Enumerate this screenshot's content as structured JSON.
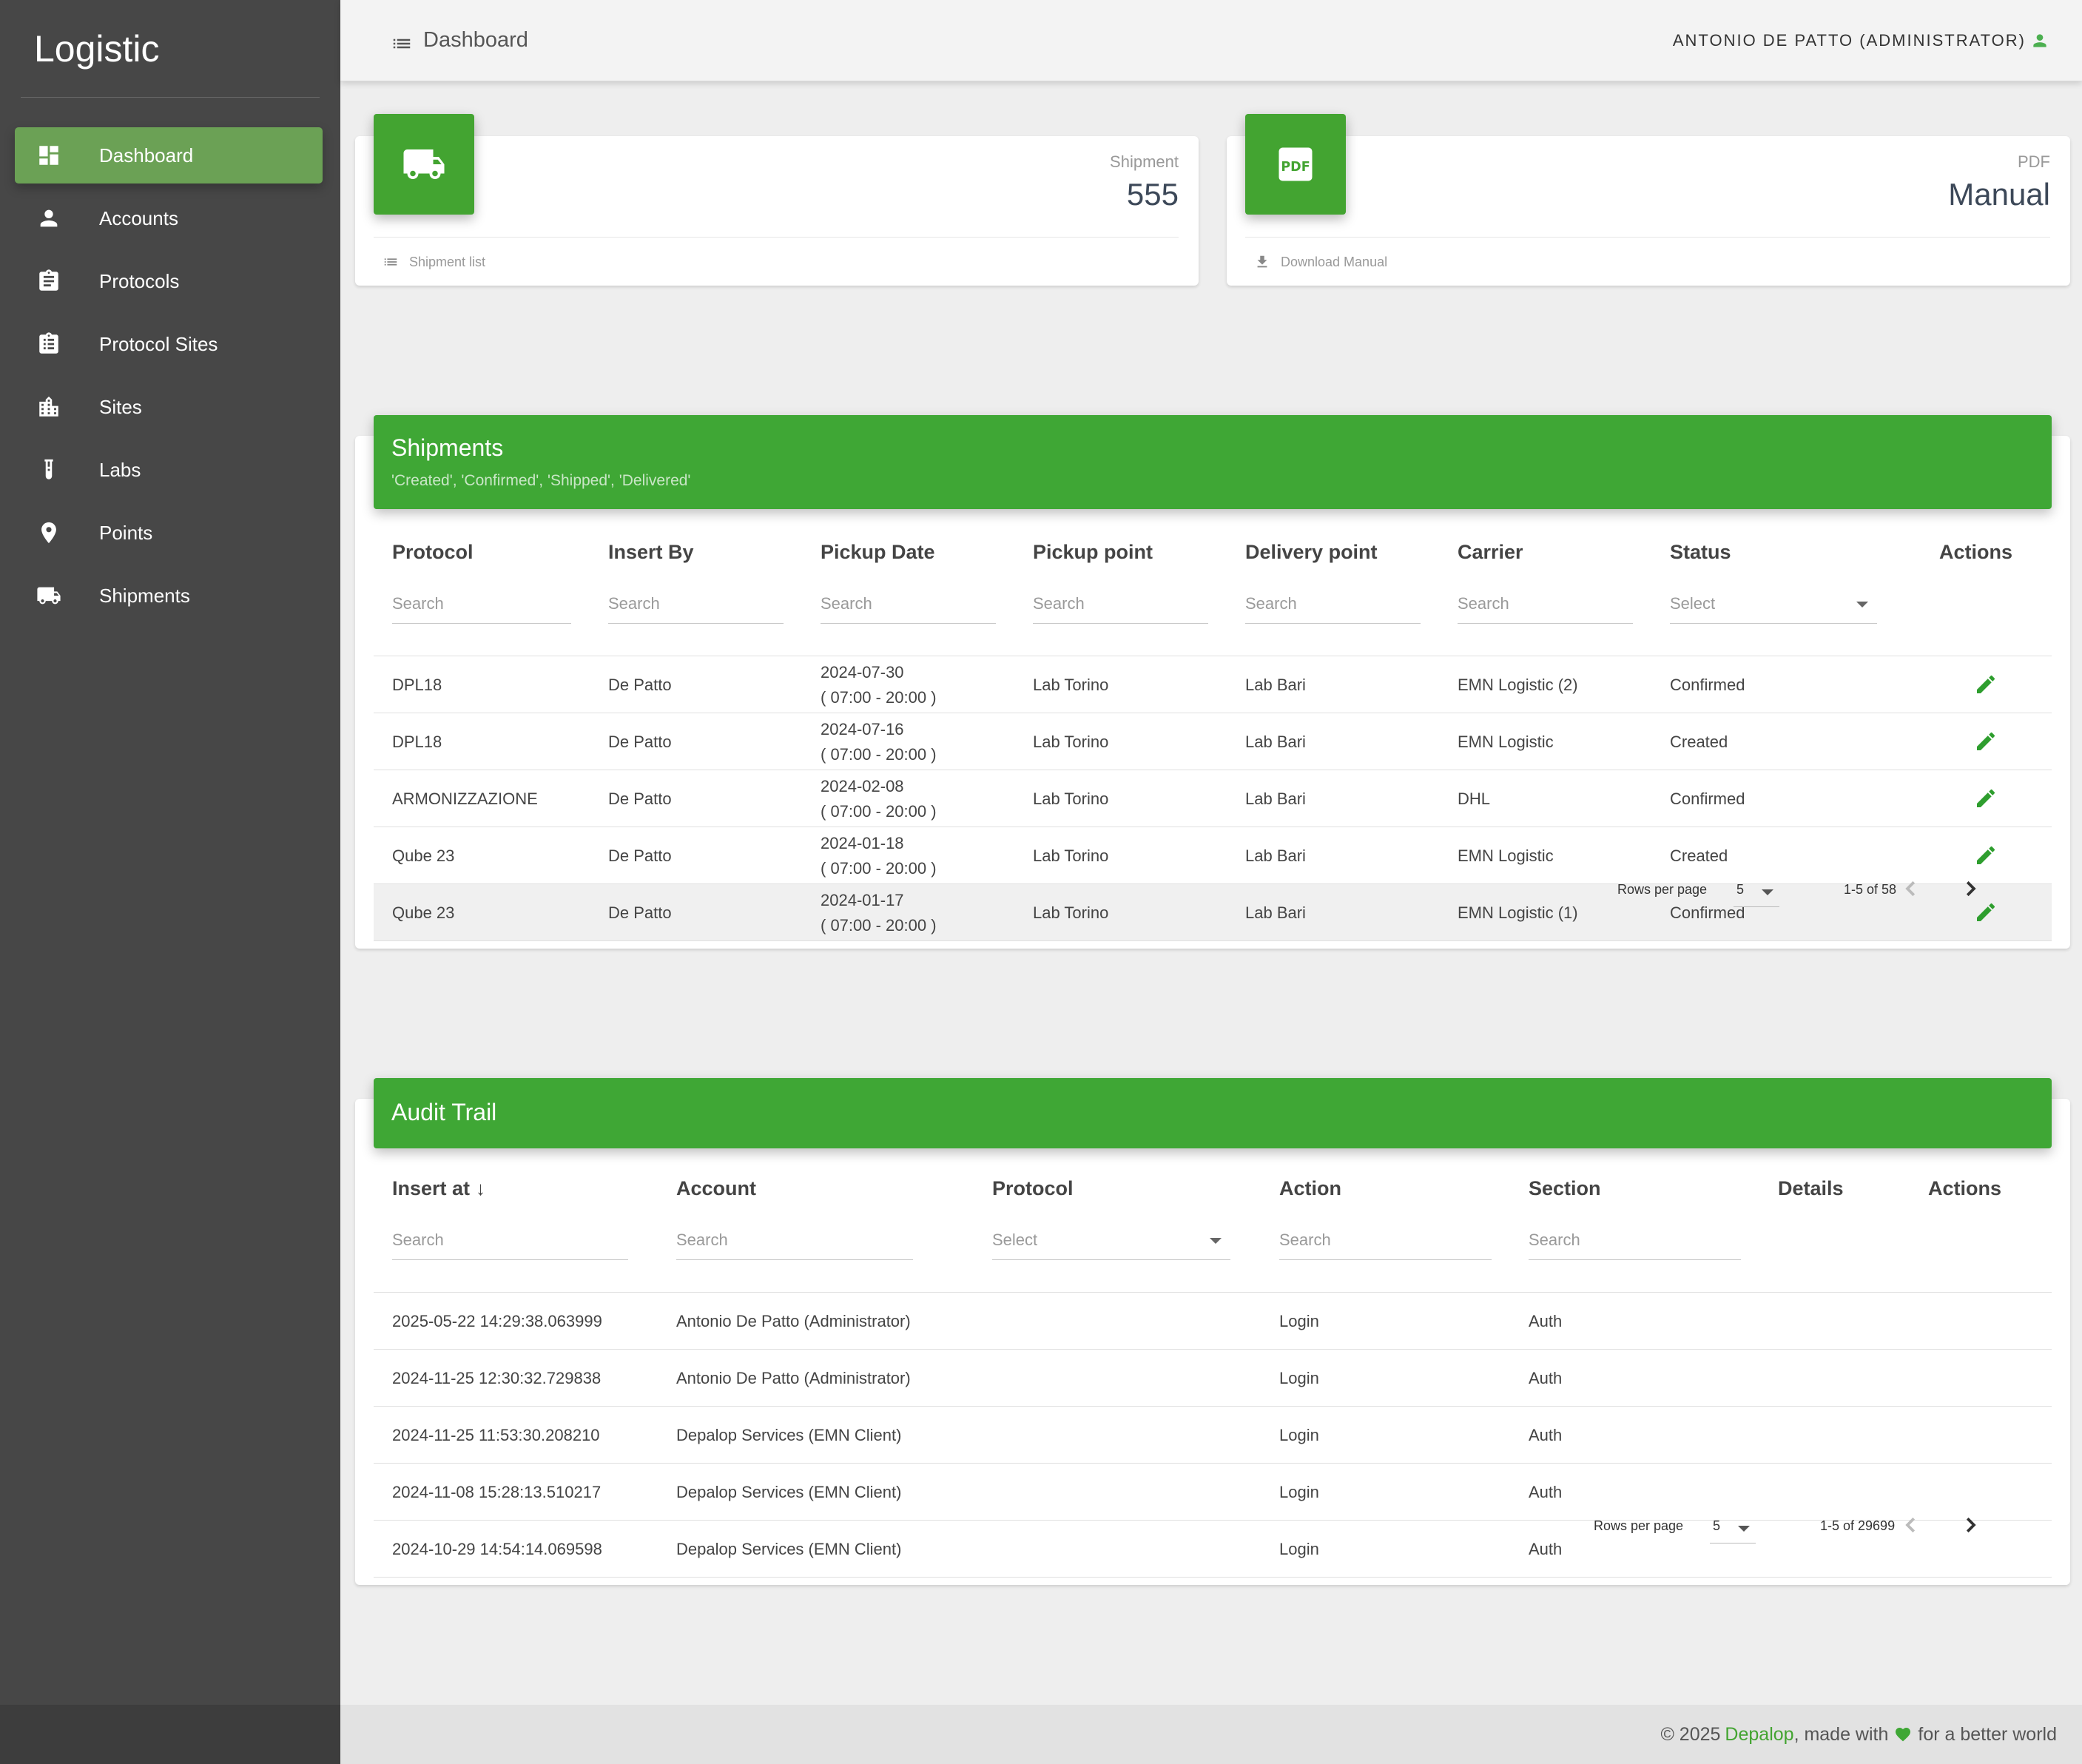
{
  "app": {
    "brand": "Logistic"
  },
  "sidebar": {
    "items": [
      {
        "label": "Dashboard",
        "icon": "dashboard-icon",
        "active": true
      },
      {
        "label": "Accounts",
        "icon": "person-icon"
      },
      {
        "label": "Protocols",
        "icon": "clipboard-icon"
      },
      {
        "label": "Protocol Sites",
        "icon": "clipboard-list-icon"
      },
      {
        "label": "Sites",
        "icon": "building-icon"
      },
      {
        "label": "Labs",
        "icon": "test-tube-icon"
      },
      {
        "label": "Points",
        "icon": "map-pin-icon"
      },
      {
        "label": "Shipments",
        "icon": "truck-icon"
      }
    ]
  },
  "topbar": {
    "title": "Dashboard",
    "user": "ANTONIO DE PATTO (ADMINISTRATOR)"
  },
  "stats": {
    "shipment": {
      "label": "Shipment",
      "value": "555",
      "footer": "Shipment list"
    },
    "manual": {
      "label": "PDF",
      "value": "Manual",
      "footer": "Download Manual"
    }
  },
  "shipments": {
    "title": "Shipments",
    "subtitle": "'Created', 'Confirmed', 'Shipped', 'Delivered'",
    "columns": [
      "Protocol",
      "Insert By",
      "Pickup Date",
      "Pickup point",
      "Delivery point",
      "Carrier",
      "Status",
      "Actions"
    ],
    "filters": {
      "protocol": "Search",
      "insert_by": "Search",
      "pickup_date": "Search",
      "pickup_point": "Search",
      "delivery_point": "Search",
      "carrier": "Search",
      "status": "Select"
    },
    "rows": [
      {
        "protocol": "DPL18",
        "insert_by": "De Patto",
        "date": "2024-07-30",
        "time": "( 07:00 - 20:00 )",
        "pickup": "Lab Torino",
        "delivery": "Lab Bari",
        "carrier": "EMN Logistic (2)",
        "status": "Confirmed"
      },
      {
        "protocol": "DPL18",
        "insert_by": "De Patto",
        "date": "2024-07-16",
        "time": "( 07:00 - 20:00 )",
        "pickup": "Lab Torino",
        "delivery": "Lab Bari",
        "carrier": "EMN Logistic",
        "status": "Created"
      },
      {
        "protocol": "ARMONIZZAZIONE",
        "insert_by": "De Patto",
        "date": "2024-02-08",
        "time": "( 07:00 - 20:00 )",
        "pickup": "Lab Torino",
        "delivery": "Lab Bari",
        "carrier": "DHL",
        "status": "Confirmed"
      },
      {
        "protocol": "Qube 23",
        "insert_by": "De Patto",
        "date": "2024-01-18",
        "time": "( 07:00 - 20:00 )",
        "pickup": "Lab Torino",
        "delivery": "Lab Bari",
        "carrier": "EMN Logistic",
        "status": "Created"
      },
      {
        "protocol": "Qube 23",
        "insert_by": "De Patto",
        "date": "2024-01-17",
        "time": "( 07:00 - 20:00 )",
        "pickup": "Lab Torino",
        "delivery": "Lab Bari",
        "carrier": "EMN Logistic (1)",
        "status": "Confirmed"
      }
    ],
    "pager": {
      "rows_per_page_label": "Rows per page",
      "rows_per_page": "5",
      "range": "1-5 of 58"
    }
  },
  "audit": {
    "title": "Audit Trail",
    "columns": [
      "Insert at",
      "Account",
      "Protocol",
      "Action",
      "Section",
      "Details",
      "Actions"
    ],
    "sort_arrow": "↓",
    "filters": {
      "insert_at": "Search",
      "account": "Search",
      "protocol": "Select",
      "action": "Search",
      "section": "Search"
    },
    "rows": [
      {
        "insert_at": "2025-05-22 14:29:38.063999",
        "account": "Antonio De Patto (Administrator)",
        "action": "Login",
        "section": "Auth"
      },
      {
        "insert_at": "2024-11-25 12:30:32.729838",
        "account": "Antonio De Patto (Administrator)",
        "action": "Login",
        "section": "Auth"
      },
      {
        "insert_at": "2024-11-25 11:53:30.208210",
        "account": "Depalop Services (EMN Client)",
        "action": "Login",
        "section": "Auth"
      },
      {
        "insert_at": "2024-11-08 15:28:13.510217",
        "account": "Depalop Services (EMN Client)",
        "action": "Login",
        "section": "Auth"
      },
      {
        "insert_at": "2024-10-29 14:54:14.069598",
        "account": "Depalop Services (EMN Client)",
        "action": "Login",
        "section": "Auth"
      }
    ],
    "pager": {
      "rows_per_page_label": "Rows per page",
      "rows_per_page": "5",
      "range": "1-5 of 29699"
    }
  },
  "footer": {
    "prefix": "© 2025",
    "brand": "Depalop",
    "middle": ", made with",
    "suffix": "for a better world"
  },
  "colors": {
    "accent": "#3fa735",
    "sidebar": "#474747",
    "edit": "#2e9e2e"
  }
}
